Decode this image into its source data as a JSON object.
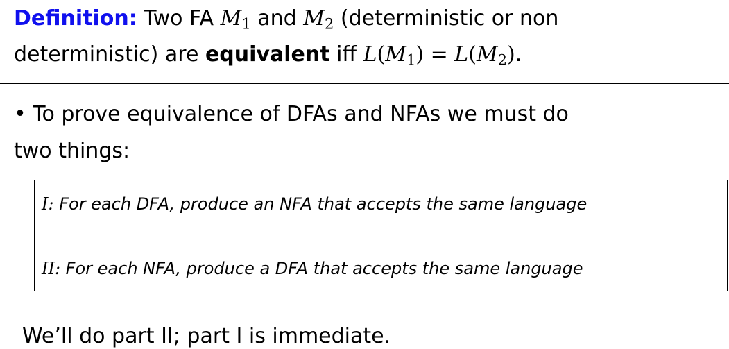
{
  "definition": {
    "label": "Definition:",
    "line1_a": "Two FA ",
    "m1": "M",
    "m1_sub": "1",
    "line1_b": " and ",
    "m2": "M",
    "m2_sub": "2",
    "line1_c": " (deterministic or non",
    "line2_a": "deterministic) are ",
    "bold_word": "equivalent",
    "line2_b": " iff ",
    "eq_L1": "L",
    "eq_open1": "(",
    "eq_M1": "M",
    "eq_sub1": "1",
    "eq_close1": ")",
    "eq_equals": " = ",
    "eq_L2": "L",
    "eq_open2": "(",
    "eq_M2": "M",
    "eq_sub2": "2",
    "eq_close2": ")",
    "line2_end": "."
  },
  "bullet": {
    "symbol": "•",
    "line1": " To prove equivalence of DFAs and NFAs we must do",
    "line2": "two things:"
  },
  "box": {
    "item1_num": "I:",
    "item1_text": " For each DFA, produce an NFA that accepts the same language",
    "item2_num": "II:",
    "item2_text": " For each NFA, produce a DFA that accepts the same language"
  },
  "conclusion": "We’ll do part II; part I is immediate.",
  "colors": {
    "definition_label": "#1010ee",
    "text": "#000000",
    "background": "#ffffff"
  }
}
